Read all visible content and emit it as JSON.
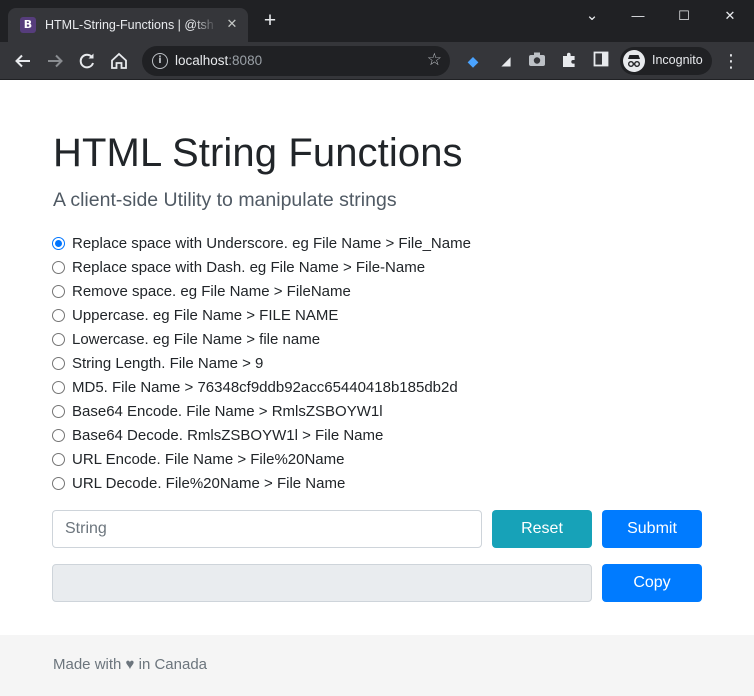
{
  "browser": {
    "tab_favicon": "B",
    "tab_title": "HTML-String-Functions | @tshen",
    "tab_close": "✕",
    "new_tab": "+",
    "window_controls": {
      "minimize": "—",
      "maximize": "☐",
      "close": "✕",
      "dropdown": "⌄"
    },
    "address_host": "localhost",
    "address_port": ":8080",
    "incognito_label": "Incognito",
    "icons": [
      "back-icon",
      "forward-icon",
      "reload-icon",
      "home-icon",
      "info-icon",
      "star-icon",
      "extension-gem-icon",
      "extension-icon-2",
      "camera-icon",
      "puzzle-icon",
      "sidebar-icon",
      "incognito-icon",
      "menu-icon"
    ]
  },
  "page": {
    "title": "HTML String Functions",
    "lead": "A client-side Utility to manipulate strings",
    "options": [
      {
        "label": "Replace space with Underscore. eg File Name > File_Name",
        "checked": true
      },
      {
        "label": "Replace space with Dash. eg File Name > File-Name",
        "checked": false
      },
      {
        "label": "Remove space. eg File Name > FileName",
        "checked": false
      },
      {
        "label": "Uppercase. eg File Name > FILE NAME",
        "checked": false
      },
      {
        "label": "Lowercase. eg File Name > file name",
        "checked": false
      },
      {
        "label": "String Length. File Name > 9",
        "checked": false
      },
      {
        "label": "MD5. File Name > 76348cf9ddb92acc65440418b185db2d",
        "checked": false
      },
      {
        "label": "Base64 Encode. File Name > RmlsZSBOYW1l",
        "checked": false
      },
      {
        "label": "Base64 Decode. RmlsZSBOYW1l > File Name",
        "checked": false
      },
      {
        "label": "URL Encode. File Name > File%20Name",
        "checked": false
      },
      {
        "label": "URL Decode. File%20Name > File Name",
        "checked": false
      }
    ],
    "input_placeholder": "String",
    "input_value": "",
    "output_value": "",
    "reset_label": "Reset",
    "submit_label": "Submit",
    "copy_label": "Copy"
  },
  "footer": {
    "text_before": "Made with",
    "heart": "♥",
    "text_after": "in Canada"
  },
  "colors": {
    "primary": "#007bff",
    "info": "#17a2b8",
    "radio_accent": "#0075ff",
    "footer_bg": "#f5f5f5",
    "chrome_dark": "#202124",
    "chrome_toolbar": "#35363a"
  }
}
